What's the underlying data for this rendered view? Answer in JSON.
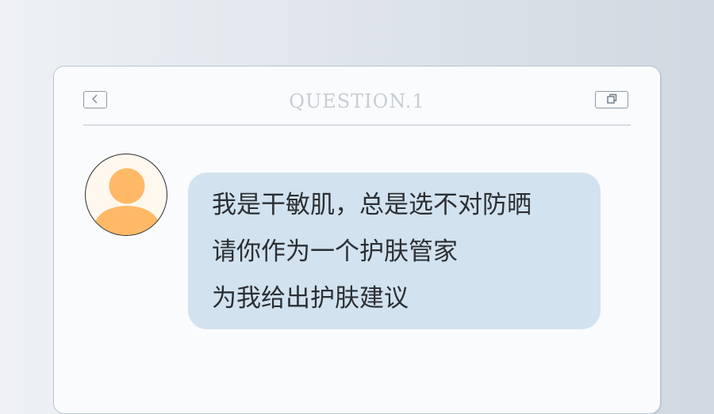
{
  "header": {
    "title": "QUESTION.1",
    "back_icon": "chevron-left-icon",
    "window_icon": "copy-window-icon"
  },
  "avatar": {
    "icon": "user-icon",
    "color": "#ffb966",
    "background": "#fff8ee"
  },
  "message": {
    "lines": [
      "我是干敏肌，总是选不对防晒",
      "请你作为一个护肤管家",
      "为我给出护肤建议"
    ],
    "bubble_color": "#d2e2ee"
  },
  "colors": {
    "card": "#f9fbfd",
    "title": "#c7cdd4",
    "text": "#2b2f33"
  }
}
